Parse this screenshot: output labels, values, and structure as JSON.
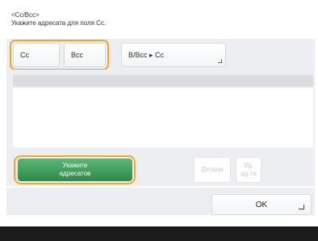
{
  "header": {
    "title": "<Cc/Bcc>",
    "subtitle": "Укажите адресата для поля Cc."
  },
  "tabs": {
    "cc_label": "Cc",
    "bcc_label": "Bcc",
    "move_label": "В/Bcc ▸ Cc"
  },
  "actions": {
    "specify_line1": "Укажите",
    "specify_line2": "адресатов",
    "details_label": "Детали",
    "delete_line1": "Уд.",
    "delete_line2": "ад-та"
  },
  "footer": {
    "ok_label": "OK"
  },
  "colors": {
    "highlight": "#f5a623",
    "primary_green": "#2e8a4a",
    "panel_bg": "#eceef1"
  }
}
